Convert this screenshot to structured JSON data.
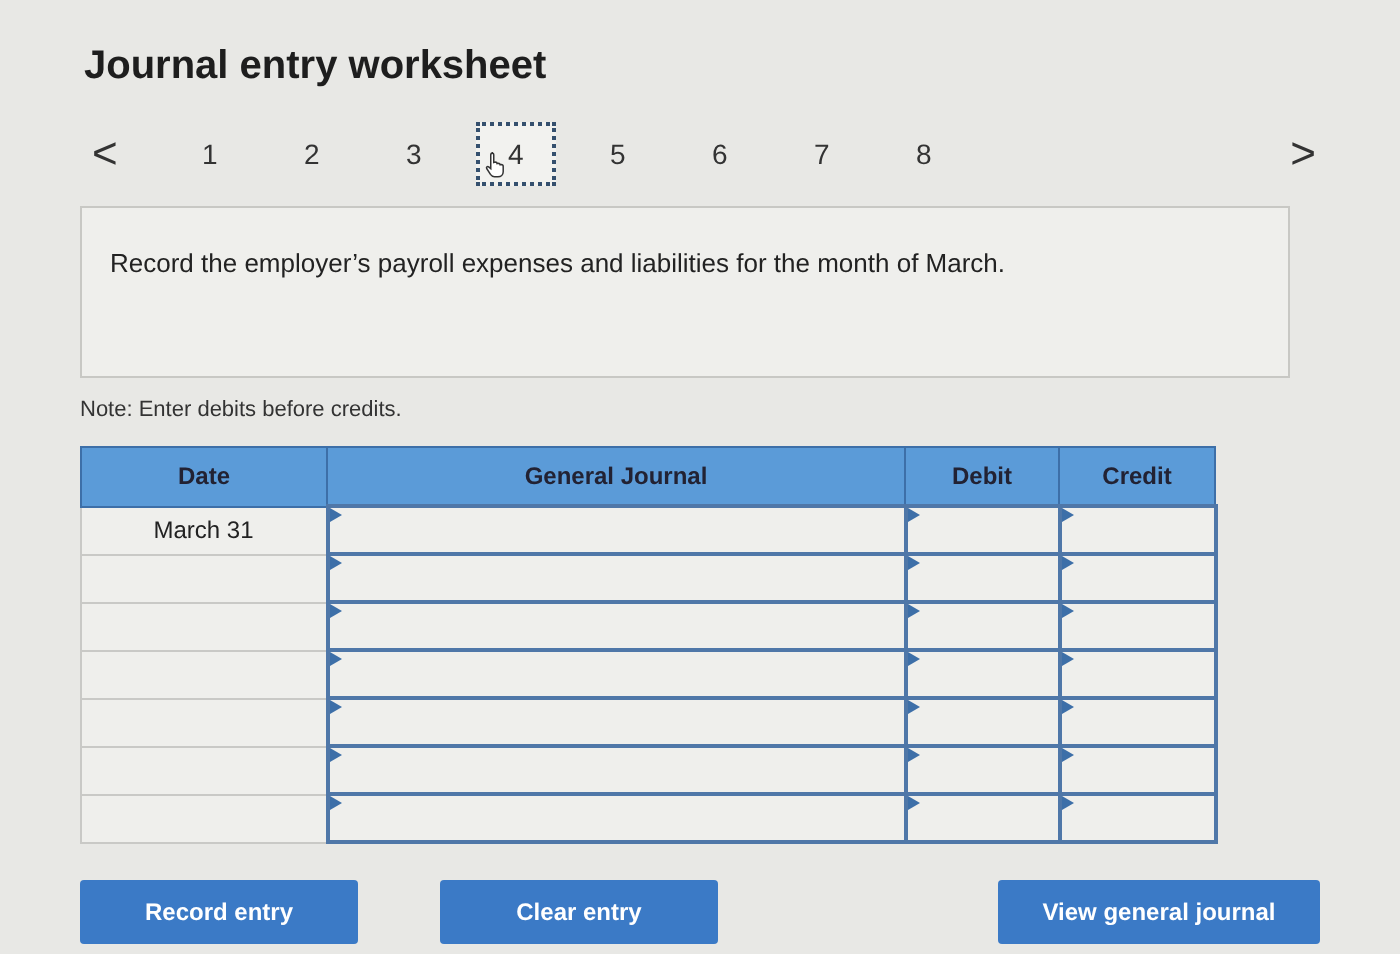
{
  "title": "Journal entry worksheet",
  "pager": {
    "prev": "<",
    "next": ">",
    "pages": [
      {
        "label": "1",
        "selected": false
      },
      {
        "label": "2",
        "selected": false
      },
      {
        "label": "3",
        "selected": false
      },
      {
        "label": "4",
        "selected": true
      },
      {
        "label": "5",
        "selected": false
      },
      {
        "label": "6",
        "selected": false
      },
      {
        "label": "7",
        "selected": false
      },
      {
        "label": "8",
        "selected": false
      }
    ]
  },
  "instruction": "Record the employer’s payroll expenses and liabilities for the month of March.",
  "note": "Note: Enter debits before credits.",
  "table": {
    "columns": [
      "Date",
      "General Journal",
      "Debit",
      "Credit"
    ],
    "rows": [
      {
        "date": "March 31"
      },
      {},
      {},
      {},
      {},
      {},
      {}
    ]
  },
  "buttons": [
    "Record entry",
    "Clear entry",
    "View general journal"
  ]
}
